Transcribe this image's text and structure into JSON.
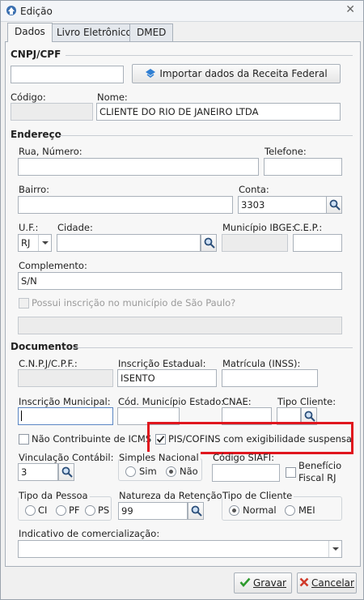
{
  "window": {
    "title": "Edição",
    "tabs": [
      {
        "label": "Dados",
        "active": true
      },
      {
        "label": "Livro Eletrônico",
        "active": false
      },
      {
        "label": "DMED",
        "active": false
      }
    ]
  },
  "cnpj_section": {
    "title": "CNPJ/CPF",
    "cnpj_value": "",
    "import_button": "Importar dados da Receita Federal",
    "codigo_label": "Código:",
    "codigo_value": "",
    "nome_label": "Nome:",
    "nome_value": "CLIENTE DO RIO DE JANEIRO LTDA"
  },
  "endereco": {
    "title": "Endereço",
    "rua_label": "Rua, Número:",
    "rua_value": "",
    "telefone_label": "Telefone:",
    "telefone_value": "",
    "bairro_label": "Bairro:",
    "bairro_value": "",
    "conta_label": "Conta:",
    "conta_value": "3303",
    "uf_label": "U.F.:",
    "uf_value": "RJ",
    "cidade_label": "Cidade:",
    "cidade_value": "",
    "municipio_label": "Município IBGE:",
    "municipio_value": "",
    "cep_label": "C.E.P.:",
    "cep_value": "",
    "complemento_label": "Complemento:",
    "complemento_value": "S/N",
    "sp_label": "Possui inscrição no município de São Paulo?",
    "sp_value": ""
  },
  "documentos": {
    "title": "Documentos",
    "cnpj_label": "C.N.P.J/C.P.F.:",
    "cnpj_value": "",
    "ie_label": "Inscrição Estadual:",
    "ie_value": "ISENTO",
    "inss_label": "Matrícula (INSS):",
    "inss_value": "",
    "im_label": "Inscrição Municipal:",
    "im_value": "",
    "cme_label": "Cód. Município Estado:",
    "cme_value": "",
    "cnae_label": "CNAE:",
    "cnae_value": "",
    "tipo_cliente_label": "Tipo Cliente:",
    "tipo_cliente_value": "",
    "icms_label": "Não Contribuinte de ICMS",
    "piscofins_label": "PIS/COFINS com exigibilidade suspensa",
    "vinc_label": "Vinculação Contábil:",
    "vinc_value": "3",
    "simples_label": "Simples Nacional",
    "simples_sim": "Sim",
    "simples_nao": "Não",
    "siafi_label": "Código SIAFI:",
    "siafi_value": "",
    "beneficio_label_1": "Benefício",
    "beneficio_label_2": "Fiscal RJ",
    "tipo_pessoa_label": "Tipo da Pessoa",
    "pessoa_ci": "CI",
    "pessoa_pf": "PF",
    "pessoa_ps": "PS",
    "natureza_label": "Natureza da Retenção:",
    "natureza_value": "99",
    "tipo_de_cliente_label": "Tipo de Cliente",
    "tc_normal": "Normal",
    "tc_mei": "MEI",
    "indicativo_label": "Indicativo de comercialização:",
    "indicativo_value": ""
  },
  "footer": {
    "gravar": "Gravar",
    "cancelar": "Cancelar"
  },
  "colors": {
    "highlight": "#e0161e",
    "gravar_check": "#2e9a2e",
    "cancelar_x": "#d03a2a"
  }
}
